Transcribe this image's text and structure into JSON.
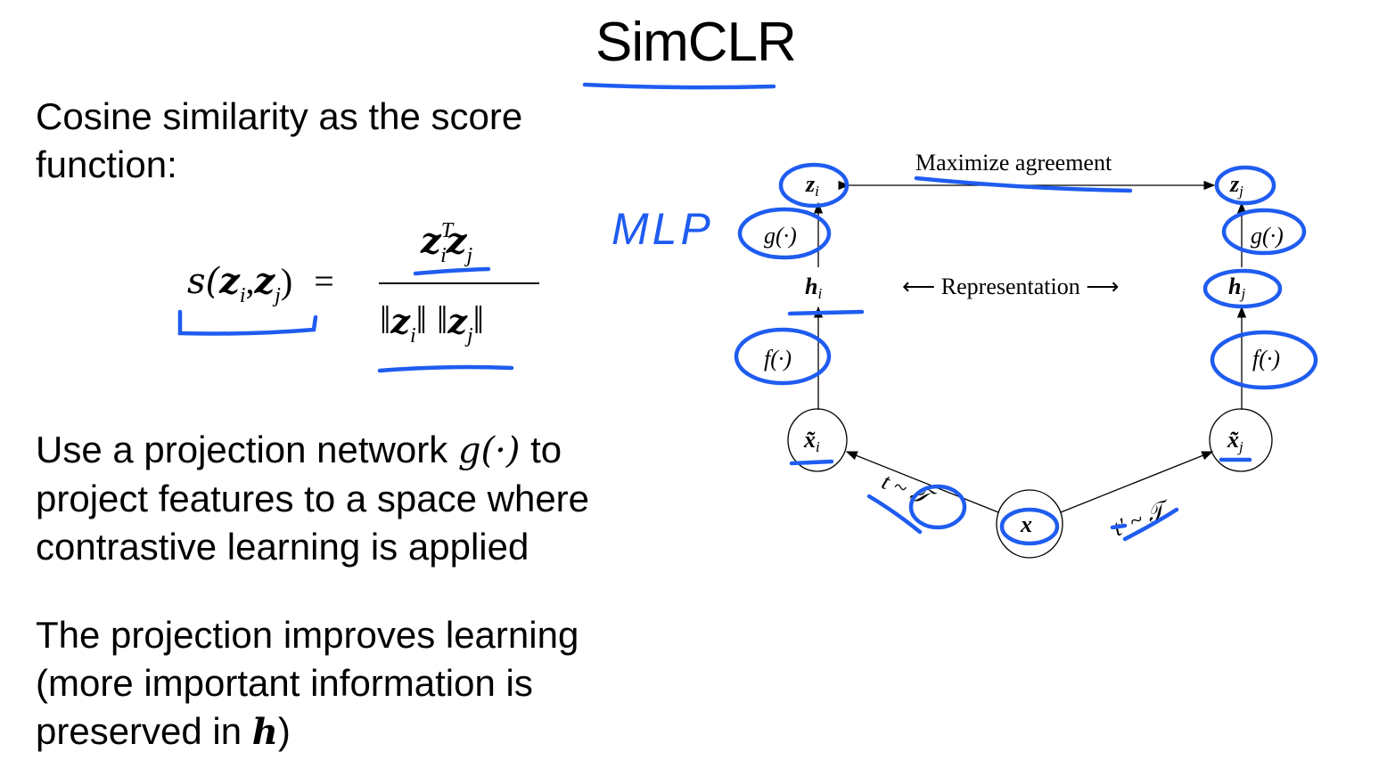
{
  "slide": {
    "title": "SimCLR",
    "para1": [
      "Cosine similarity as the score",
      "function:"
    ],
    "formula": {
      "lhs_s": "s(",
      "z": "z",
      "i": "i",
      "j": "j",
      "comma": ",",
      "close": ")",
      "eq": "=",
      "T": "T",
      "norm_open": "‖",
      "norm_close": "‖"
    },
    "para2": {
      "line1_pre": "Use a projection network ",
      "g_symbol": "g(·)",
      "line1_post": " to",
      "line2": "project features to a space where",
      "line3": "contrastive learning is applied"
    },
    "para3": {
      "line1": "The projection improves learning",
      "line2": "(more important information is",
      "line3_pre": "preserved in ",
      "h_symbol": "h",
      "line3_post": ")"
    }
  },
  "diagram": {
    "maximize": "Maximize agreement",
    "representation": "⟵ Representation ⟶",
    "z": "z",
    "h": "h",
    "x": "x",
    "xt": "x̃",
    "sub_i": "i",
    "sub_j": "j",
    "g": "g(·)",
    "f": "f(·)",
    "t_left": "t ~ 𝒯",
    "t_right": "t′ ~ 𝒯"
  },
  "annotations": {
    "mlp": "MLP",
    "ink_color": "#1f5cf0"
  }
}
